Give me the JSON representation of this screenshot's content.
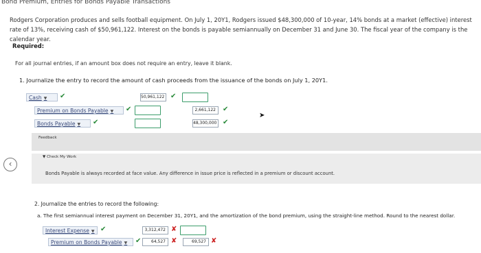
{
  "header": {
    "title": "Bond Premium, Entries for Bonds Payable Transactions"
  },
  "problem": {
    "intro": "Rodgers Corporation produces and sells football equipment. On July 1, 20Y1, Rodgers issued $48,300,000 of 10-year, 14% bonds at a market (effective) interest rate of 13%, receiving cash of $50,961,122. Interest on the bonds is payable semiannually on December 31 and June 30. The fiscal year of the company is the calendar year.",
    "required_label": "Required:",
    "instruction": "For all journal entries, if an amount box does not require an entry, leave it blank."
  },
  "q1": {
    "text": "1.  Journalize the entry to record the amount of cash proceeds from the issuance of the bonds on July 1, 20Y1.",
    "rows": [
      {
        "account": "Cash",
        "debit": "50,961,122",
        "credit": ""
      },
      {
        "account": "Premium on Bonds Payable",
        "debit": "",
        "credit": "2,661,122"
      },
      {
        "account": "Bonds Payable",
        "debit": "",
        "credit": "48,300,000"
      }
    ]
  },
  "feedback": {
    "label": "Feedback",
    "check_label": "▼ Check My Work",
    "check_text": "Bonds Payable is always recorded at face value. Any difference in issue price is reflected in a premium or discount account."
  },
  "q2": {
    "text": "2.  Journalize the entries to record the following:",
    "part_a": "a.   The first semiannual interest payment on December 31, 20Y1, and the amortization of the bond premium, using the straight-line method. Round to the nearest dollar.",
    "rows": [
      {
        "account": "Interest Expense",
        "debit": "3,312,472",
        "credit": ""
      },
      {
        "account": "Premium on Bonds Payable",
        "debit": "64,527",
        "credit": "69,527"
      }
    ]
  },
  "icons": {
    "check": "✔",
    "cross": "✘",
    "caret": "▼",
    "back": "‹"
  },
  "colors": {
    "check": "#2a8a3a",
    "cross": "#cc1f1f",
    "box_border": "#3b9c6a",
    "feedback_bg": "#e3e3e3"
  }
}
